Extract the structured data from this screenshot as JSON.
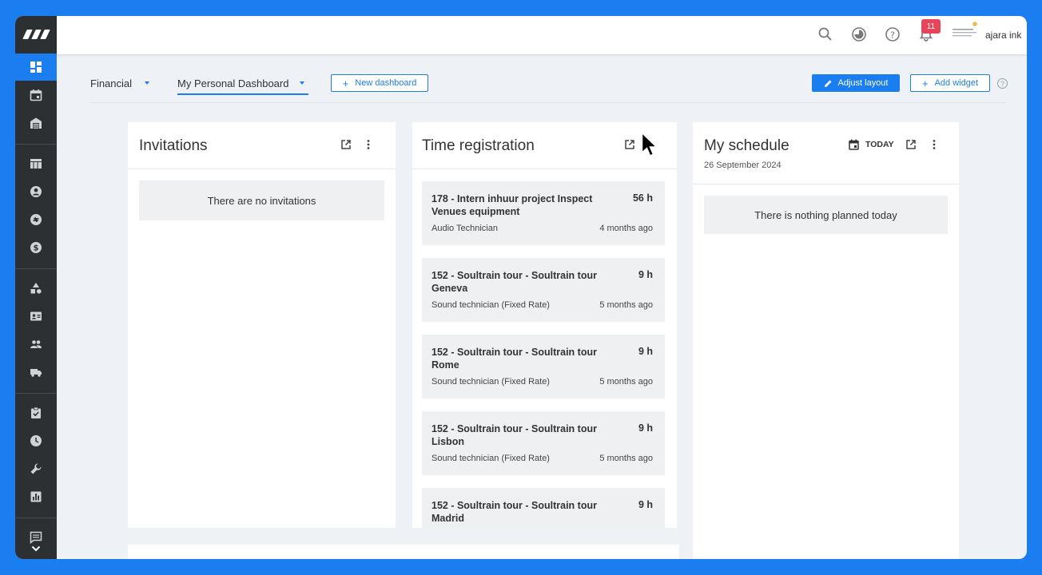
{
  "topbar": {
    "notification_count": "11",
    "user_name": "ajara ink"
  },
  "dashboard": {
    "tabs": [
      {
        "label": "Financial"
      },
      {
        "label": "My Personal Dashboard"
      }
    ],
    "new_dashboard_label": "New dashboard",
    "adjust_layout_label": "Adjust layout",
    "add_widget_label": "Add widget",
    "help_label": "?"
  },
  "invitations": {
    "title": "Invitations",
    "empty_text": "There are no invitations"
  },
  "time_registration": {
    "title": "Time registration",
    "entries": [
      {
        "title": "178 - Intern inhuur project Inspect Venues equipment",
        "hours": "56 h",
        "role": "Audio Technician",
        "time": "4 months ago"
      },
      {
        "title": "152 - Soultrain tour - Soultrain tour Geneva",
        "hours": "9 h",
        "role": "Sound technician (Fixed Rate)",
        "time": "5 months ago"
      },
      {
        "title": "152 - Soultrain tour - Soultrain tour Rome",
        "hours": "9 h",
        "role": "Sound technician (Fixed Rate)",
        "time": "5 months ago"
      },
      {
        "title": "152 - Soultrain tour - Soultrain tour Lisbon",
        "hours": "9 h",
        "role": "Sound technician (Fixed Rate)",
        "time": "5 months ago"
      },
      {
        "title": "152 - Soultrain tour - Soultrain tour Madrid",
        "hours": "9 h",
        "role": "",
        "time": ""
      }
    ]
  },
  "schedule": {
    "title": "My schedule",
    "today_label": "TODAY",
    "date": "26 September 2024",
    "empty_text": "There is nothing planned today"
  },
  "colors": {
    "accent": "#1a7df0",
    "sidebar": "#2c3033",
    "badge": "#e8445a"
  }
}
